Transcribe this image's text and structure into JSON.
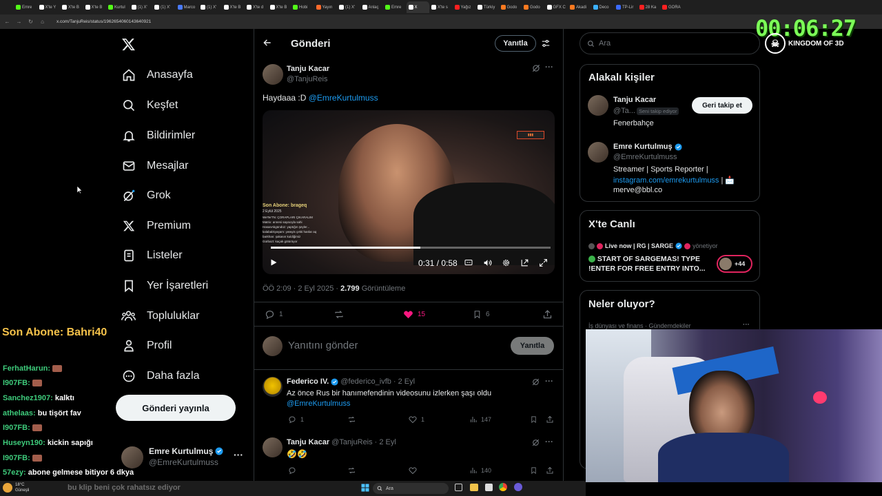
{
  "browser": {
    "tabs": [
      {
        "label": "Emre",
        "color": "#53fc18"
      },
      {
        "label": "X'te Y",
        "color": "#ffffff"
      },
      {
        "label": "X'te B",
        "color": "#ffffff"
      },
      {
        "label": "X'te B",
        "color": "#ffffff"
      },
      {
        "label": "Kurtul",
        "color": "#53fc18"
      },
      {
        "label": "(1) X'",
        "color": "#ffffff"
      },
      {
        "label": "(1) X'",
        "color": "#ffffff"
      },
      {
        "label": "Marco",
        "color": "#4a7bff"
      },
      {
        "label": "(1) X'",
        "color": "#ffffff"
      },
      {
        "label": "X'te B",
        "color": "#ffffff"
      },
      {
        "label": "X'te d",
        "color": "#ffffff"
      },
      {
        "label": "X'te B",
        "color": "#ffffff"
      },
      {
        "label": "Hobi",
        "color": "#53fc18"
      },
      {
        "label": "Yayın",
        "color": "#ff6a2b"
      },
      {
        "label": "(1) X'",
        "color": "#ffffff"
      },
      {
        "label": "Anlaç",
        "color": "#ffffff"
      },
      {
        "label": "Emre",
        "color": "#53fc18"
      },
      {
        "label": "X",
        "color": "#ffffff",
        "active": true
      },
      {
        "label": "X'te s",
        "color": "#ffffff"
      },
      {
        "label": "Yağız",
        "color": "#ff2020"
      },
      {
        "label": "Türkiy",
        "color": "#ffffff"
      },
      {
        "label": "Godo",
        "color": "#ff7a20"
      },
      {
        "label": "Godo",
        "color": "#ff7a20"
      },
      {
        "label": "GFX C",
        "color": "#ffffff"
      },
      {
        "label": "Akadi",
        "color": "#ff7a20"
      },
      {
        "label": "Deco",
        "color": "#3bb0ff"
      },
      {
        "label": "TP-Lir",
        "color": "#3b6bff"
      },
      {
        "label": "28 Ka",
        "color": "#ff2020"
      },
      {
        "label": "GORA",
        "color": "#ff2020"
      }
    ],
    "url": "x.com/TanjuReis/status/1962654060143640921"
  },
  "overlay": {
    "timer": "00:06:27",
    "brand": "KINGDOM OF 3D"
  },
  "nav": {
    "items": [
      "Anasayfa",
      "Keşfet",
      "Bildirimler",
      "Mesajlar",
      "Grok",
      "Premium",
      "Listeler",
      "Yer İşaretleri",
      "Topluluklar",
      "Profil",
      "Daha fazla"
    ],
    "post_button": "Gönderi yayınla",
    "account_name": "Emre Kurtulmuş",
    "account_handle": "@EmreKurtulmuss"
  },
  "chat": {
    "last_sub": "Son Abone: Bahri40",
    "messages": [
      {
        "user": "FerhatHarun:",
        "text": "",
        "emoji": true
      },
      {
        "user": "I907FB:",
        "text": "",
        "emoji": true
      },
      {
        "user": "Sanchez1907:",
        "text": "kalktı",
        "emoji": false
      },
      {
        "user": "athelaas:",
        "text": "bu tişört fav",
        "emoji": false
      },
      {
        "user": "I907FB:",
        "text": "",
        "emoji": true
      },
      {
        "user": "Huseyn190:",
        "text": "kickin sapığı",
        "emoji": false
      },
      {
        "user": "I907FB:",
        "text": "",
        "emoji": true
      },
      {
        "user": "57ezy:",
        "text": "abone gelmese bitiyor 6 dkya",
        "emoji": false
      }
    ],
    "subtitle": "bu klip beni çok rahatsız ediyor"
  },
  "post": {
    "header_title": "Gönderi",
    "reply_chip": "Yanıtla",
    "author_name": "Tanju Kacar",
    "author_handle": "@TanjuReis",
    "text": "Haydaaa :D",
    "mention": "@EmreKurtulmuss",
    "video": {
      "time": "0:31 / 0:58",
      "progress": 0.534,
      "overlay_sub": "Son Abone: brageq",
      "overlay_date": "2 Eylül 2025",
      "chat_lines": [
        "WeTerTN: ÇORAPLARI ÇIKARALIM",
        "Matrix: annesi sayacıyla sahi",
        "HasanAkgündüz: yaptığın şeyler...",
        "kalabalıkyaşam: ywwyis çekti hanlar aq",
        "barkhan: şakasın kuldiğimiz",
        "Gürbazt: kaçak götürüyor"
      ]
    },
    "timestamp": "ÖÖ 2:09 · 2 Eyl 2025 ·",
    "views_count": "2.799",
    "views_label": "Görüntüleme",
    "stats": {
      "replies": "1",
      "likes": "15",
      "bookmarks": "6"
    },
    "reply_placeholder": "Yanıtını gönder",
    "reply_button": "Yanıtla"
  },
  "replies": [
    {
      "name": "Federico IV.",
      "handle": "@federico_ivfb",
      "date": "· 2 Eyl",
      "text": "Az önce Rus bir hanımefendinin videosunu izlerken şaşı oldu",
      "mention": "@EmreKurtulmuss",
      "replies": "1",
      "likes": "1",
      "views": "147"
    },
    {
      "name": "Tanju Kacar",
      "handle": "@TanjuReis",
      "date": "· 2 Eyl",
      "text": "🤣🤣",
      "mention": "",
      "replies": "",
      "likes": "",
      "views": "140"
    }
  ],
  "sidebar": {
    "search_placeholder": "Ara",
    "related_title": "Alakalı kişiler",
    "people": [
      {
        "name": "Tanju Kacar",
        "handle": "@Ta...",
        "badge": "Seni takip ediyor",
        "button": "Geri takip et",
        "bio": "Fenerbahçe"
      },
      {
        "name": "Emre Kurtulmuş",
        "handle": "@EmreKurtulmuss",
        "bio1": "Streamer | Sports Reporter |",
        "bio_link": "instagram.com/emrekurtulmuss",
        "bio2": "|",
        "bio3": "merve@bbl.co"
      }
    ],
    "live_title": "X'te Canlı",
    "live_host": "Live now | RG | SARGE",
    "live_role": "yönetiyor",
    "live_text1": "START OF SARGEMAS! TYPE",
    "live_text2": "!ENTER FOR FREE ENTRY INTO...",
    "live_count": "+44",
    "trends_title": "Neler oluyor?",
    "trends_sub": "İş dünyası ve finans · Gündemdekiler"
  },
  "taskbar": {
    "weather_temp": "18°C",
    "weather_desc": "Güneşli",
    "search": "Ara"
  },
  "colors": {
    "accent": "#1d9bf0",
    "like": "#f91880",
    "timer": "#7cff58",
    "chat_user": "#3ecb7b"
  }
}
